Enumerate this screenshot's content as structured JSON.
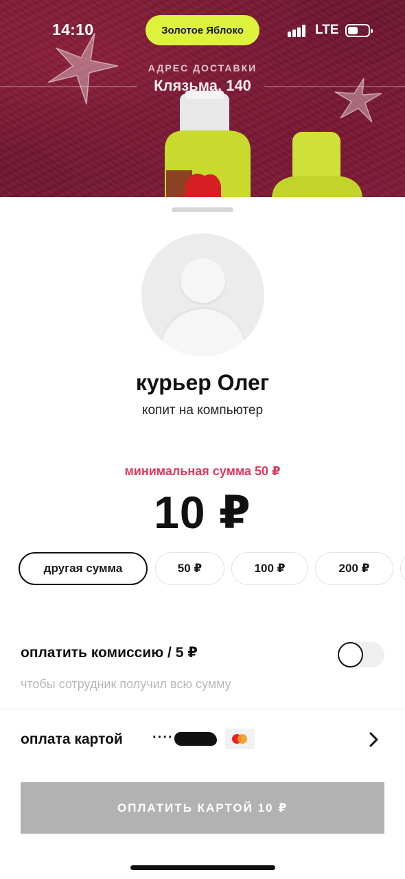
{
  "status_bar": {
    "time": "14:10",
    "pill_label": "Золотое Яблоко",
    "network": "LTE"
  },
  "delivery": {
    "caption": "АДРЕС ДОСТАВКИ",
    "address": "Клязьма, 140"
  },
  "courier": {
    "name": "курьер Олег",
    "goal": "копит на компьютер"
  },
  "tip": {
    "min_sum": "минимальная сумма 50 ₽",
    "amount": "10 ₽",
    "chips": [
      "другая сумма",
      "50 ₽",
      "100 ₽",
      "200 ₽"
    ]
  },
  "commission": {
    "title": "оплатить комиссию / 5 ₽",
    "hint": "чтобы сотрудник получил всю сумму",
    "enabled": false
  },
  "payment": {
    "label": "оплата картой",
    "card_mask": "····"
  },
  "pay_button": {
    "label": "ОПЛАТИТЬ КАРТОЙ 10 ₽"
  },
  "colors": {
    "banner": "#7d1a35",
    "pill": "#ddf23c",
    "accent_pink": "#e8375e",
    "button_disabled": "#b2b2b2"
  }
}
